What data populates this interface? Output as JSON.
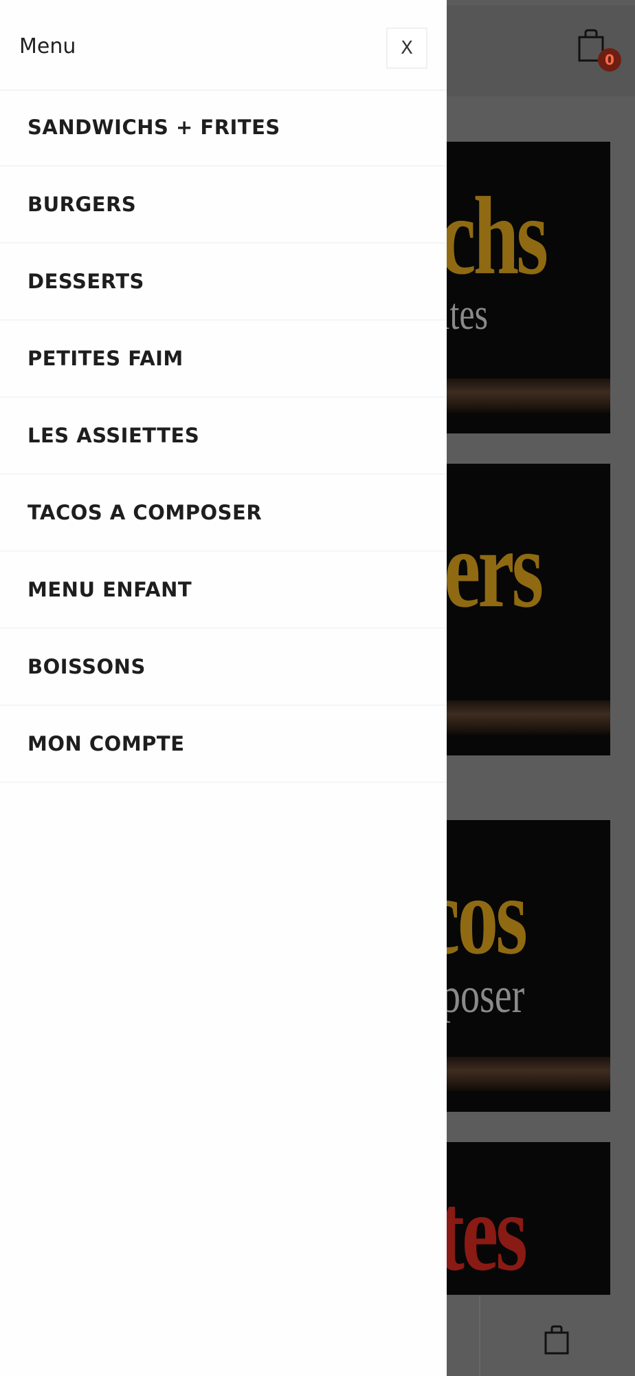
{
  "drawer": {
    "title": "Menu",
    "close_label": "X",
    "items": [
      {
        "label": "SANDWICHS + FRITES"
      },
      {
        "label": "BURGERS"
      },
      {
        "label": "DESSERTS"
      },
      {
        "label": "PETITES FAIM"
      },
      {
        "label": "LES ASSIETTES"
      },
      {
        "label": "TACOS A COMPOSER"
      },
      {
        "label": "MENU ENFANT"
      },
      {
        "label": "BOISSONS"
      },
      {
        "label": "MON COMPTE"
      }
    ]
  },
  "background": {
    "cart_count": "0",
    "tiles": [
      {
        "big": "ichs",
        "small": "rites",
        "big_color": "#8f6a12"
      },
      {
        "big": "gers",
        "small": "",
        "big_color": "#8f6a12"
      },
      {
        "big": "cos",
        "small": "nposer",
        "big_color": "#8f6a12"
      },
      {
        "big": "ttes",
        "small": "",
        "big_color": "#8a1a14"
      }
    ]
  },
  "colors": {
    "overlay": "#5c5c5c",
    "drawer_bg": "#fefefe",
    "badge_bg": "#6e1f12",
    "badge_text": "#ff6b4a"
  },
  "icons": {
    "cart": "shopping-bag-icon",
    "close": "close-icon"
  }
}
